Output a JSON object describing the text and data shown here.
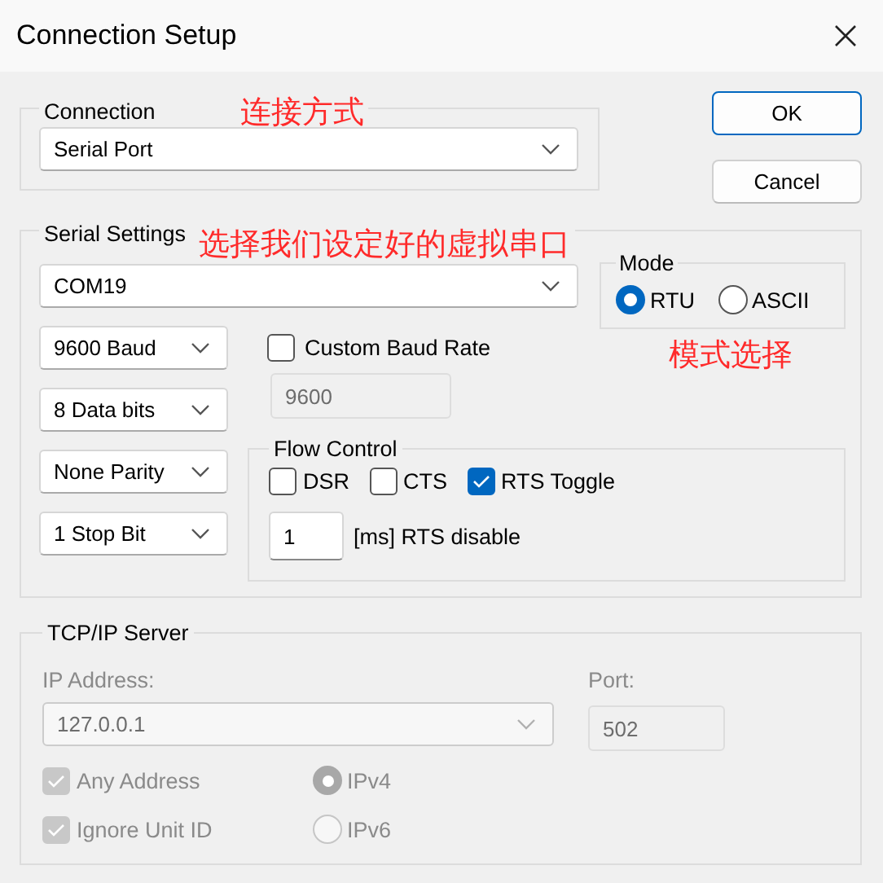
{
  "window": {
    "title": "Connection Setup"
  },
  "connection": {
    "label": "Connection",
    "annotation": "连接方式",
    "value": "Serial Port"
  },
  "buttons": [
    {
      "label": "OK",
      "default": true
    },
    {
      "label": "Cancel",
      "default": false
    }
  ],
  "serial_settings": {
    "label": "Serial Settings",
    "annotation": "选择我们设定好的虚拟串口",
    "port": "COM19",
    "baud": "9600 Baud",
    "data_bits": "8 Data bits",
    "parity": "None Parity",
    "stop_bits": "1 Stop Bit",
    "custom_baud": {
      "label": "Custom Baud Rate",
      "checked": false
    },
    "custom_baud_value": {
      "value": "9600",
      "disabled": true
    },
    "mode": {
      "label": "Mode",
      "annotation": "模式选择",
      "options": [
        {
          "label": "RTU",
          "selected": true
        },
        {
          "label": "ASCII",
          "selected": false
        }
      ]
    },
    "flow_control": {
      "label": "Flow Control",
      "options": [
        {
          "label": "DSR",
          "checked": false
        },
        {
          "label": "CTS",
          "checked": false
        },
        {
          "label": "RTS Toggle",
          "checked": true
        }
      ],
      "rts_delay": "1",
      "rts_delay_label": "[ms] RTS disable"
    }
  },
  "tcp_server": {
    "label": "TCP/IP Server",
    "disabled": true,
    "ip_label": "IP Address:",
    "ip": "127.0.0.1",
    "port_label": "Port:",
    "port": "502",
    "options": [
      {
        "label": "Any Address",
        "checked": true
      },
      {
        "label": "Ignore Unit ID",
        "checked": true
      }
    ],
    "ip_versions": [
      {
        "label": "IPv4",
        "selected": true
      },
      {
        "label": "IPv6",
        "selected": false
      }
    ]
  }
}
